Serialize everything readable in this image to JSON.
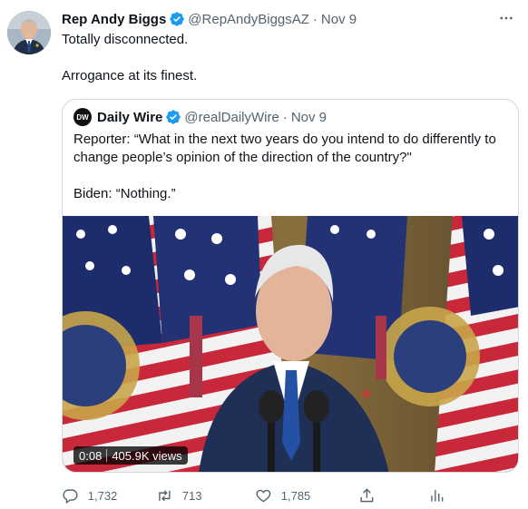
{
  "author": {
    "name": "Rep Andy Biggs",
    "handle": "@RepAndyBiggsAZ",
    "separator": "·",
    "date": "Nov 9",
    "verified": true
  },
  "tweet": {
    "lines": [
      "Totally disconnected.",
      "Arrogance at its finest."
    ]
  },
  "quoted": {
    "avatar_text": "DW",
    "name": "Daily Wire",
    "handle": "@realDailyWire",
    "separator": "·",
    "date": "Nov 9",
    "verified": true,
    "paragraphs": [
      "Reporter: “What in the next two years do you intend to do differently to change people’s opinion of the direction of the country?\"",
      "Biden: “Nothing.”"
    ],
    "video": {
      "time": "0:08",
      "views": "405.9K views"
    }
  },
  "actions": {
    "replies": "1,732",
    "retweets": "713",
    "likes": "1,785"
  },
  "icons": {
    "verified": "verified-badge-icon",
    "more": "more-icon",
    "reply": "reply-icon",
    "retweet": "retweet-icon",
    "like": "heart-icon",
    "share": "share-icon",
    "analytics": "analytics-icon"
  },
  "colors": {
    "verified": "#1d9bf0",
    "text": "#0f1419",
    "muted": "#536471",
    "border": "#cfd9de"
  }
}
